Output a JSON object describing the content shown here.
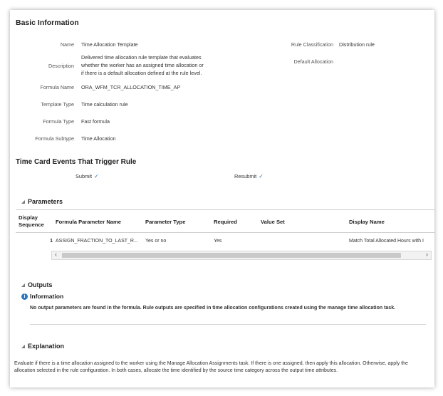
{
  "basic_info": {
    "title": "Basic Information",
    "fields": [
      {
        "label": "Name",
        "value": "Time Allocation Template"
      },
      {
        "label": "Description",
        "value_lines": [
          "Delivered time allocation rule template that evaluates",
          "whether the worker has an assigned time allocation or",
          "if there is a default allocation defined at the rule level."
        ]
      },
      {
        "label": "Formula Name",
        "value": "ORA_WFM_TCR_ALLOCATION_TIME_AP"
      },
      {
        "label": "Template Type",
        "value": "Time calculation rule"
      },
      {
        "label": "Formula Type",
        "value": "Fast formula"
      },
      {
        "label": "Formula Subtype",
        "value": "Time Allocation"
      }
    ],
    "rule_classification_label": "Rule Classification",
    "rule_classification_value": "Distribution rule",
    "default_allocation_label": "Default Allocation"
  },
  "events": {
    "title": "Time Card Events That Trigger Rule",
    "submit_label": "Submit",
    "resubmit_label": "Resubmit",
    "check_glyph": "✓"
  },
  "parameters": {
    "title": "Parameters",
    "columns": [
      "Display Sequence",
      "Formula Parameter Name",
      "Parameter Type",
      "Required",
      "Value Set",
      "Display Name"
    ],
    "column_lines": {
      "display_sequence_1": "Display",
      "display_sequence_2": "Sequence"
    },
    "rows": [
      {
        "seq": "1",
        "name": "ASSIGN_FRACTION_TO_LAST_R...",
        "type": "Yes or no",
        "required": "Yes",
        "value_set": "",
        "display_name": "Match Total Allocated Hours with I"
      }
    ],
    "scroll_left": "‹",
    "scroll_right": "›"
  },
  "outputs": {
    "title": "Outputs",
    "info_title": "Information",
    "info_icon": "i",
    "message": "No output parameters are found in the formula. Rule outputs are specified in time allocation configurations created using the manage time allocation task."
  },
  "explanation": {
    "title": "Explanation",
    "text": "Evaluate if there is a time allocation assigned to the worker using the Manage Allocation Assignments task. If there is one assigned, then apply this allocation. Otherwise, apply the allocation selected in the rule configuration. In both cases, allocate the time identified by the source time category across the output time attributes."
  }
}
